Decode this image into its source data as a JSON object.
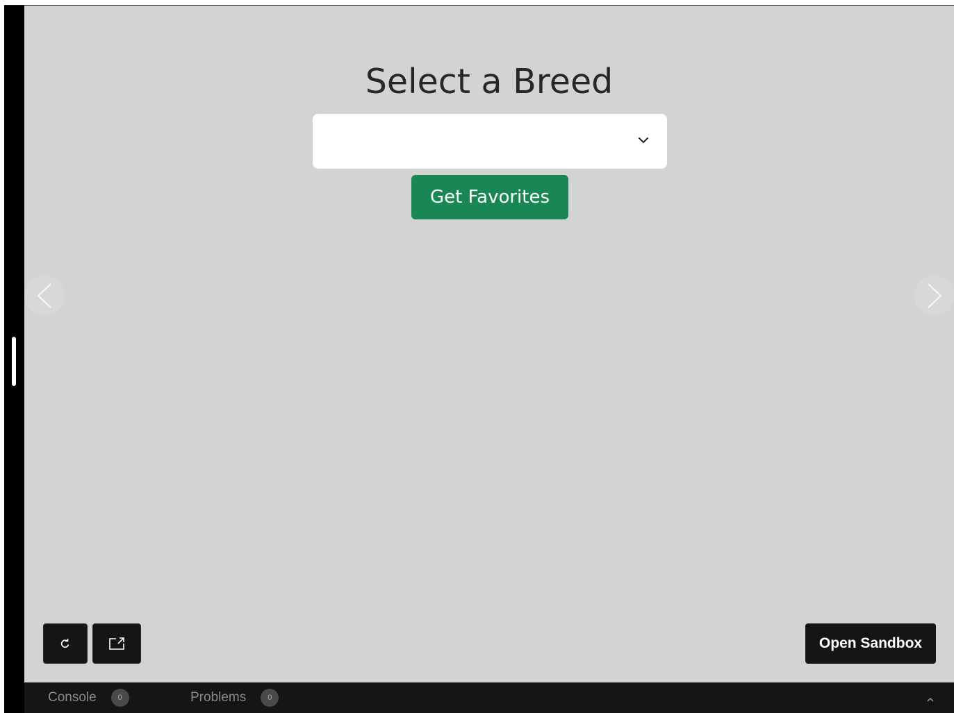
{
  "preview": {
    "title": "Select a Breed",
    "breed_select": {
      "value": "",
      "icon": "chevron-down-icon"
    },
    "get_favorites_label": "Get Favorites",
    "carousel": {
      "prev_icon": "chevron-left-icon",
      "next_icon": "chevron-right-icon"
    }
  },
  "toolbar": {
    "refresh_icon": "refresh-icon",
    "open_new_window_icon": "open-in-new-window-icon",
    "open_sandbox_label": "Open Sandbox"
  },
  "bottom_bar": {
    "tabs": [
      {
        "label": "Console",
        "count": "0"
      },
      {
        "label": "Problems",
        "count": "0"
      }
    ],
    "expand_icon": "chevron-up-icon"
  },
  "colors": {
    "preview_background": "#d3d3d3",
    "primary_button": "#198754",
    "dark_ui": "#151515"
  }
}
